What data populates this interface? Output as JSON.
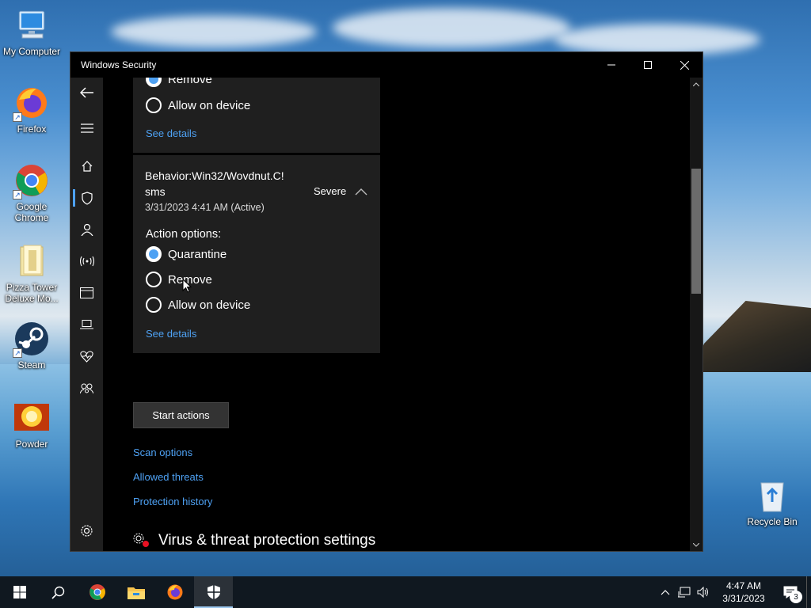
{
  "desktop": {
    "icons": [
      {
        "label": "My Computer",
        "icon": "computer-icon"
      },
      {
        "label": "Firefox",
        "icon": "firefox-icon"
      },
      {
        "label": "Google Chrome",
        "icon": "chrome-icon"
      },
      {
        "label": "Pizza Tower Deluxe Mo...",
        "icon": "folder-icon"
      },
      {
        "label": "Steam",
        "icon": "steam-icon"
      },
      {
        "label": "Powder",
        "icon": "powder-icon"
      },
      {
        "label": "Recycle Bin",
        "icon": "recycle-bin-icon"
      }
    ]
  },
  "window": {
    "title": "Windows Security",
    "controls": {
      "minimize": "minimize-icon",
      "maximize": "maximize-icon",
      "close": "close-icon"
    }
  },
  "nav": {
    "items": [
      "back-icon",
      "menu-icon",
      "home-icon",
      "shield-icon",
      "account-icon",
      "firewall-icon",
      "app-browser-icon",
      "device-security-icon",
      "health-icon",
      "family-icon"
    ],
    "settings": "gear-icon"
  },
  "threat_prev": {
    "options": [
      {
        "label": "Remove",
        "checked": true
      },
      {
        "label": "Allow on device",
        "checked": false
      }
    ],
    "see_details": "See details"
  },
  "threat": {
    "name_line1": "Behavior:Win32/Wovdnut.C!",
    "name_line2": "sms",
    "severity": "Severe",
    "timestamp": "3/31/2023 4:41 AM (Active)",
    "action_label": "Action options:",
    "options": [
      {
        "label": "Quarantine",
        "checked": true
      },
      {
        "label": "Remove",
        "checked": false
      },
      {
        "label": "Allow on device",
        "checked": false
      }
    ],
    "see_details": "See details"
  },
  "actions": {
    "start": "Start actions",
    "links": [
      "Scan options",
      "Allowed threats",
      "Protection history"
    ]
  },
  "settings_heading": "Virus & threat protection settings",
  "taskbar": {
    "apps": [
      "start-icon",
      "search-icon",
      "chrome-icon",
      "file-explorer-icon",
      "firefox-icon",
      "windows-security-icon"
    ],
    "time": "4:47 AM",
    "date": "3/31/2023",
    "notifications": "3"
  },
  "colors": {
    "accent": "#4ea1f3",
    "card": "#1f1f1f",
    "window": "#000000"
  }
}
